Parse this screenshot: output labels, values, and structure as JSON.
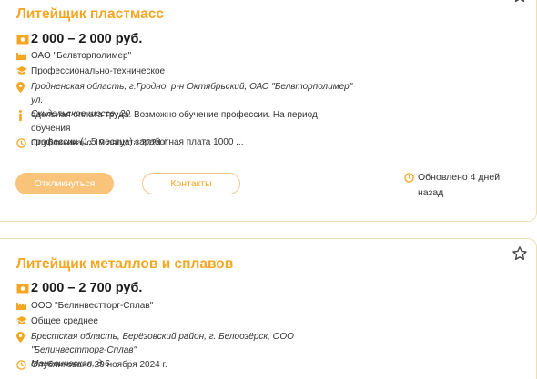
{
  "colors": {
    "accent": "#f5a623",
    "button_fill": "#f9c37a",
    "border": "#f0ddb4"
  },
  "vacancies": [
    {
      "title": "Литейщик пластмасс",
      "salary": "2 000 – 2 000 руб.",
      "company": "ОАО \"Белвторполимер\"",
      "education": "Профессионально-техническое",
      "address_line1": "Гродненская область, г.Гродно, р-н Октябрьский, ОАО \"Белвторполимер\" ул.",
      "address_line2": "Скидельское шоссе, 20",
      "info_line1": "сдельная оплата труда. Возможно обучение профессии. На период обучения",
      "info_line2": "профессии (1,5 месяца) заработная плата 1000 ...",
      "published": "Опубликовано 19 августа 2024 г.",
      "respond_label": "Откликнуться",
      "contacts_label": "Контакты",
      "updated_line1": "Обновлено 4 дней",
      "updated_line2": "назад",
      "icons": [
        "money-icon",
        "factory-icon",
        "graduation-cap-icon",
        "location-pin-icon",
        "info-icon",
        "clock-icon",
        "star-icon"
      ]
    },
    {
      "title": "Литейщик металлов и сплавов",
      "salary": "2 000 – 2 700 руб.",
      "company": "ООО \"Белинвестторг-Сплав\"",
      "education": "Общее среднее",
      "address_line1": "Брестская область, Берёзовский район, г. Белоозёрск, ООО \"Белинвестторг-Сплав\"",
      "address_line2": "Маневическая, д.6",
      "published": "Опубликовано 29 ноября 2024 г."
    }
  ]
}
